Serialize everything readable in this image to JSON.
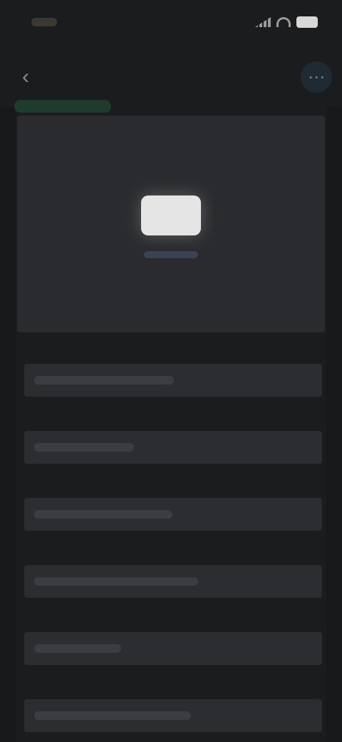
{
  "status_bar": {
    "time": "",
    "icons": [
      "signal-icon",
      "wifi-icon",
      "battery-icon"
    ]
  },
  "header": {
    "title": "",
    "back_icon": "chevron-left-icon",
    "action_icon": "more-icon"
  },
  "indicator": {
    "label": ""
  },
  "preview": {
    "caption": ""
  },
  "rows": [
    {
      "label": "",
      "value": ""
    },
    {
      "label": "",
      "value": ""
    },
    {
      "label": "",
      "value": ""
    },
    {
      "label": "",
      "value": ""
    },
    {
      "label": "",
      "value": ""
    },
    {
      "label": "",
      "value": ""
    }
  ],
  "colors": {
    "background": "#1b1c1e",
    "card": "#2a2b2e",
    "field": "#2c2d30",
    "accent_green": "#4bc07c",
    "accent_blue": "#5d7f97"
  }
}
